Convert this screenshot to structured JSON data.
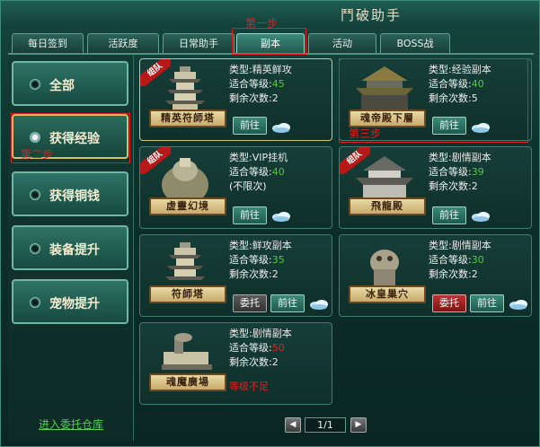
{
  "window": {
    "title": "鬥破助手"
  },
  "annotations": {
    "step1": "第一步",
    "step2": "第二步",
    "step3": "第三步"
  },
  "tabs": [
    {
      "label": "每日签到",
      "active": false
    },
    {
      "label": "活跃度",
      "active": false
    },
    {
      "label": "日常助手",
      "active": false
    },
    {
      "label": "副本",
      "active": true
    },
    {
      "label": "活动",
      "active": false
    },
    {
      "label": "BOSS战",
      "active": false
    }
  ],
  "sidebar": {
    "items": [
      {
        "label": "全部",
        "selected": false
      },
      {
        "label": "获得经验",
        "selected": true
      },
      {
        "label": "获得铜钱",
        "selected": false
      },
      {
        "label": "装备提升",
        "selected": false
      },
      {
        "label": "宠物提升",
        "selected": false
      }
    ],
    "link": "进入委托仓库"
  },
  "labels": {
    "type": "类型:",
    "level": "适合等级:",
    "remaining": "剩余次数:",
    "team": "组队"
  },
  "cards": [
    {
      "name": "精英符師塔",
      "team": true,
      "type": "精英鲜攻",
      "level": "45",
      "remaining": "2",
      "buttons": [
        "前往"
      ]
    },
    {
      "name": "魂帝殿下層",
      "team": false,
      "type": "经验副本",
      "level": "40",
      "remaining": "5",
      "buttons": [
        "前往"
      ]
    },
    {
      "name": "虚靈幻境",
      "team": true,
      "type": "VIP挂机",
      "level": "40",
      "remaining": "(不限次)",
      "buttons": [
        "前往"
      ]
    },
    {
      "name": "飛龍殿",
      "team": true,
      "type": "剧情副本",
      "level": "39",
      "remaining": "2",
      "buttons": [
        "前往"
      ]
    },
    {
      "name": "符師塔",
      "team": false,
      "type": "鲜攻副本",
      "level": "35",
      "remaining": "2",
      "buttons": [
        "委托",
        "前往"
      ]
    },
    {
      "name": "冰皇巢穴",
      "team": false,
      "type": "剧情副本",
      "level": "30",
      "remaining": "2",
      "buttons": [
        "委托",
        "前往"
      ]
    },
    {
      "name": "魂魔廣場",
      "team": false,
      "type": "剧情副本",
      "level": "50",
      "remaining": "2",
      "buttons": [],
      "warning": "等级不足"
    }
  ],
  "pager": {
    "current": "1/1",
    "prev": "◀",
    "next": "▶"
  },
  "colors": {
    "level_ok": "#52c93a",
    "level_bad": "#e02020",
    "annotation": "#e02020"
  }
}
